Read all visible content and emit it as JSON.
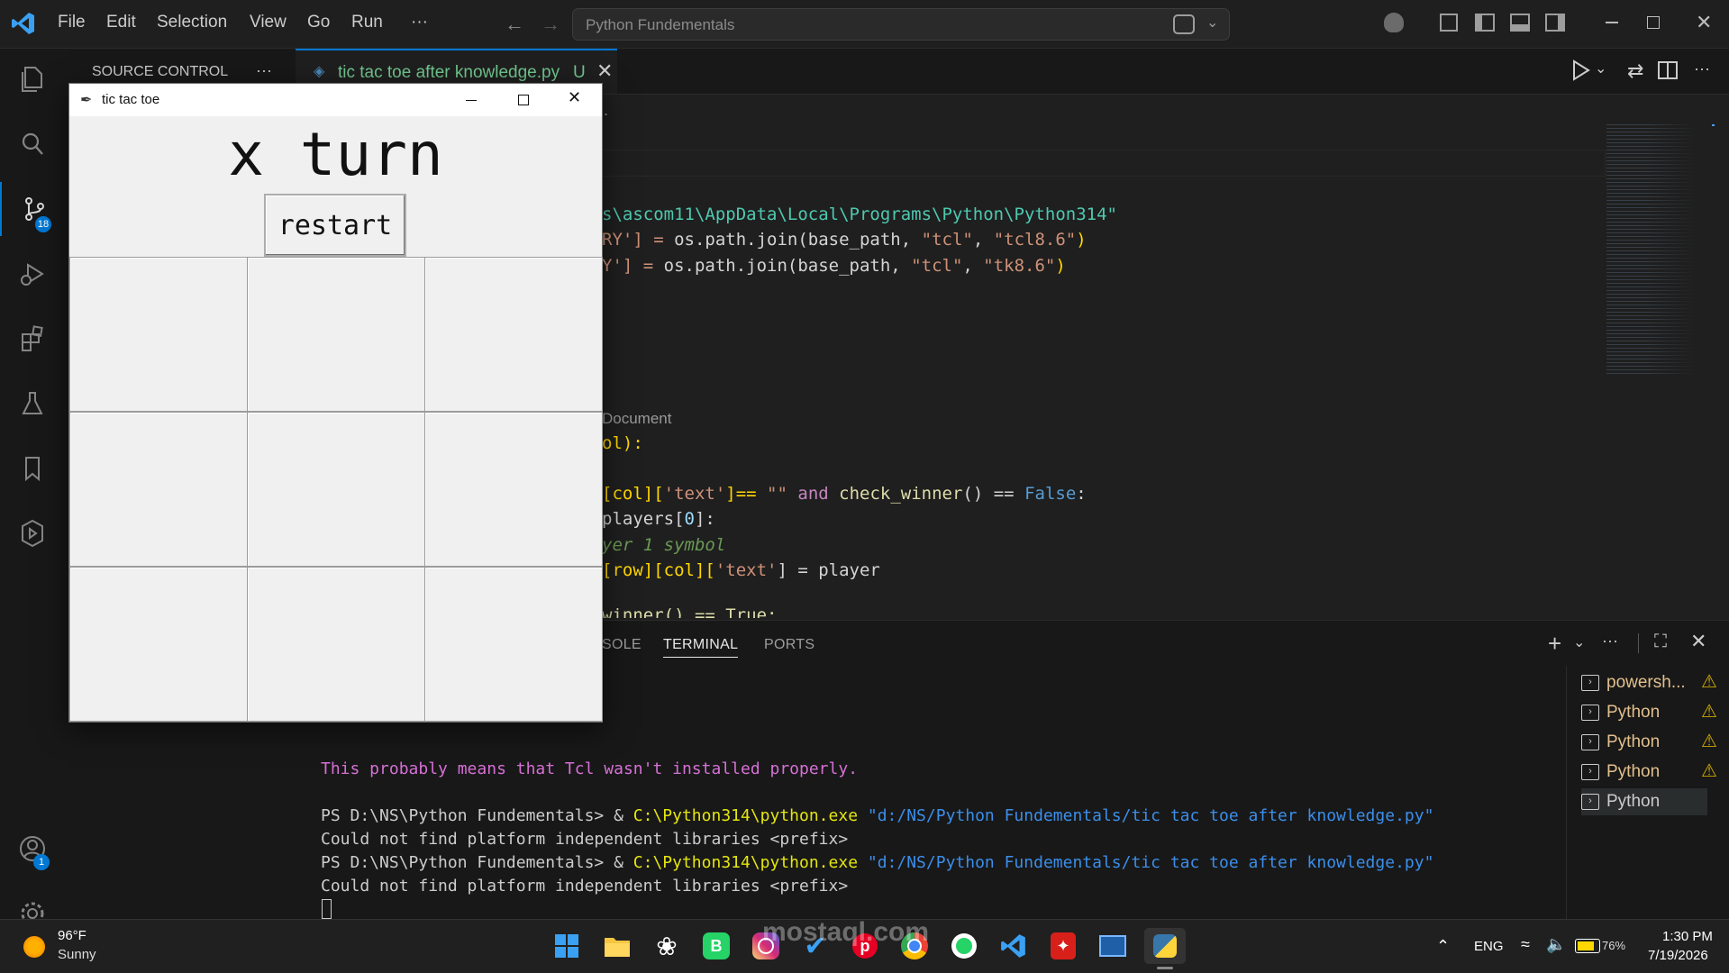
{
  "titlebar": {
    "menu": [
      "File",
      "Edit",
      "Selection",
      "View",
      "Go",
      "Run",
      "···"
    ],
    "search_text": "Python Fundementals"
  },
  "activitybar": {
    "scm_badge": "18",
    "accounts_badge": "1"
  },
  "sidebar": {
    "title": "SOURCE CONTROL",
    "more": "···"
  },
  "editor": {
    "tab_label": "tic tac toe after knowledge.py",
    "tab_status": "U",
    "breadcrumb_more": "...",
    "codelens": "Document",
    "code": {
      "l1": "s\\ascom11\\AppData\\Local\\Programs\\Python\\Python314\"",
      "l2a": "RY'] = ",
      "l2b": "os.path.join(base_path, ",
      "l2c": "\"tcl\"",
      "l2d": ", ",
      "l2e": "\"tcl8.6\"",
      "l2f": ")",
      "l3a": "Y'] = ",
      "l3b": "os.path.join(base_path, ",
      "l3c": "\"tcl\"",
      "l3d": ", ",
      "l3e": "\"tk8.6\"",
      "l3f": ")",
      "l4": "ol):",
      "l5a": "[col][",
      "l5b": "'text'",
      "l5c": "]== ",
      "l5d": "\"\"",
      "l5e": " and ",
      "l5f": "check_winner",
      "l5g": "() == ",
      "l5h": "False",
      "l5i": ":",
      "l6a": "players[",
      "l6b": "0",
      "l6c": "]:",
      "l7": "yer 1 symbol",
      "l8a": "[row][col][",
      "l8b": "'text'",
      "l8c": "] = player",
      "l9": "winner() == True:"
    }
  },
  "panel": {
    "tabs": [
      "SOLE",
      "TERMINAL",
      "PORTS"
    ],
    "active_tab": "TERMINAL",
    "terminal_lines": [
      "This probably means that Tcl wasn't installed properly.",
      "PS D:\\NS\\Python Fundementals> & ",
      "C:\\Python314\\python.exe",
      "\"d:/NS/Python Fundementals/tic tac toe after knowledge.py\"",
      "Could not find platform independent libraries <prefix>"
    ],
    "terminals": [
      "powersh...",
      "Python",
      "Python",
      "Python",
      "Python"
    ]
  },
  "tk": {
    "title": "tic tac toe",
    "turn_label": "x turn",
    "restart_label": "restart"
  },
  "taskbar": {
    "temp": "96°F",
    "weather": "Sunny",
    "lang": "ENG",
    "time": "1:30 PM",
    "date": "7/19/2026",
    "battery": "76%"
  },
  "watermark": "mostaql.com"
}
